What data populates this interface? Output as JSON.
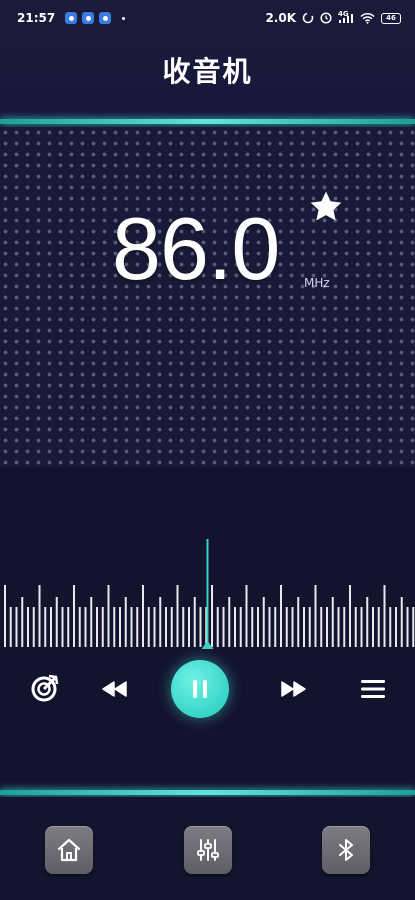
{
  "status_bar": {
    "time": "21:57",
    "network_speed": "2.0K",
    "signal_label": "4G",
    "battery": "46"
  },
  "header": {
    "title": "收音机"
  },
  "tuner": {
    "frequency": "86.0",
    "unit": "MHz",
    "favorite_icon": "star-icon",
    "dial_position": 0.5
  },
  "controls": {
    "scan_icon": "radar-icon",
    "prev_icon": "rewind-icon",
    "play_pause_icon": "pause-icon",
    "next_icon": "fast-forward-icon",
    "list_icon": "menu-icon"
  },
  "bottom_nav": {
    "items": [
      "home-icon",
      "equalizer-icon",
      "bluetooth-icon"
    ]
  },
  "colors": {
    "accent": "#3ad3c8",
    "background": "#14132d",
    "button_gray": "#6d6d73"
  }
}
